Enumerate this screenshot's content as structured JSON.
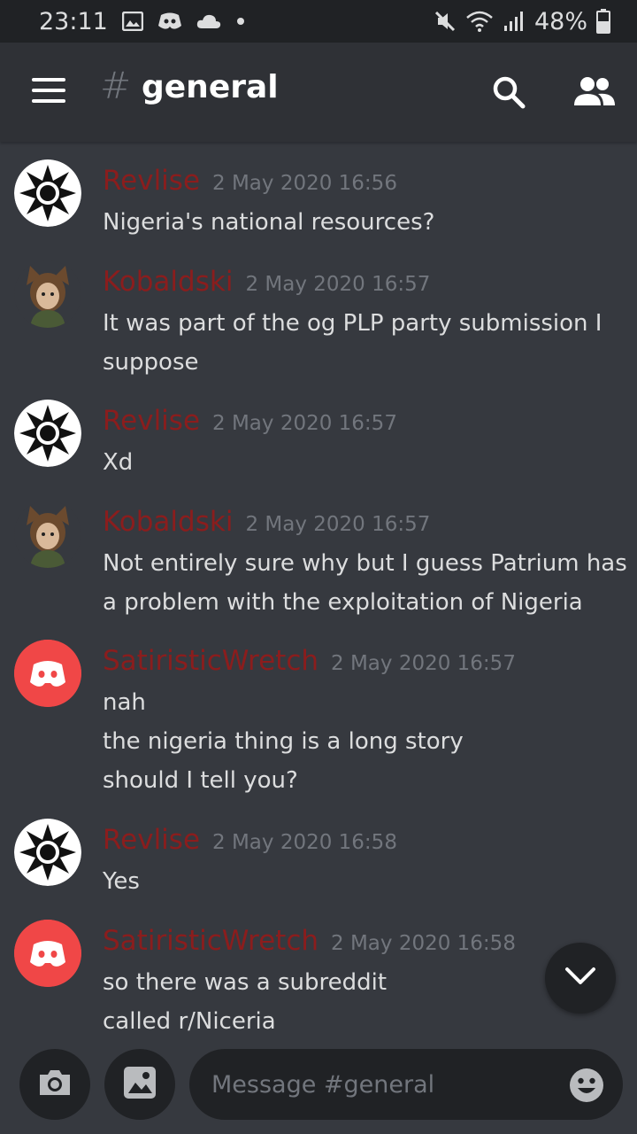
{
  "status_bar": {
    "time": "23:11",
    "battery": "48%",
    "icons": [
      "image-icon",
      "discord-notification-icon",
      "cloud-icon",
      "dot-icon",
      "mute-icon",
      "wifi-icon",
      "signal-icon",
      "battery-icon"
    ]
  },
  "header": {
    "hash": "#",
    "channel": "general",
    "icons": [
      "menu-icon",
      "search-icon",
      "members-icon"
    ]
  },
  "colors": {
    "author": "#8b1d1d",
    "discord_red": "#f04747",
    "background": "#36393f",
    "header": "#2f3136"
  },
  "messages": [
    {
      "author": "Revlise",
      "timestamp": "2 May 2020 16:56",
      "avatar": "revlise-avatar",
      "lines": [
        "Nigeria's national resources?"
      ]
    },
    {
      "author": "Kobaldski",
      "timestamp": "2 May 2020 16:57",
      "avatar": "kobaldski-avatar",
      "lines": [
        "It was part of the og PLP party submission I",
        "suppose"
      ]
    },
    {
      "author": "Revlise",
      "timestamp": "2 May 2020 16:57",
      "avatar": "revlise-avatar",
      "lines": [
        "Xd"
      ]
    },
    {
      "author": "Kobaldski",
      "timestamp": "2 May 2020 16:57",
      "avatar": "kobaldski-avatar",
      "lines": [
        "Not entirely sure why but I guess Patrium has",
        "a problem with the exploitation of Nigeria"
      ]
    },
    {
      "author": "SatiristicWretch",
      "timestamp": "2 May 2020 16:57",
      "avatar": "discord-default-avatar",
      "lines": [
        "nah",
        "the nigeria thing is a long story",
        "should I tell you?"
      ]
    },
    {
      "author": "Revlise",
      "timestamp": "2 May 2020 16:58",
      "avatar": "revlise-avatar",
      "lines": [
        "Yes"
      ]
    },
    {
      "author": "SatiristicWretch",
      "timestamp": "2 May 2020 16:58",
      "avatar": "discord-default-avatar",
      "lines": [
        "so there was a subreddit",
        "called r/Niceria"
      ]
    }
  ],
  "composer": {
    "placeholder": "Message #general",
    "icons": [
      "camera-icon",
      "gallery-icon",
      "emoji-icon"
    ]
  },
  "jump_button": {
    "icon": "chevron-down-icon"
  }
}
